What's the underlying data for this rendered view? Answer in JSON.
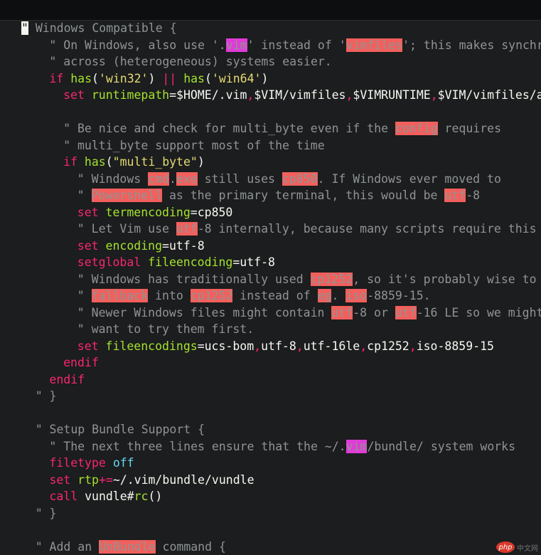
{
  "colors": {
    "background": "#1b1d1e",
    "comment": "#909493",
    "keyword": "#f92672",
    "function": "#a6e22e",
    "string": "#e6db74",
    "spell_bad": "#f25f5c",
    "spell_rare": "#e03bd8"
  },
  "editor": {
    "lines": [
      {
        "indent": 0,
        "tokens": [
          {
            "t": "\"",
            "c": "cursor"
          },
          {
            "t": " Windows Compatible {",
            "c": "comment"
          }
        ]
      },
      {
        "indent": 2,
        "tokens": [
          {
            "t": "\" On Windows, also use '.",
            "c": "comment"
          },
          {
            "t": "vim",
            "c": "spell-magenta"
          },
          {
            "t": "' instead of '",
            "c": "comment"
          },
          {
            "t": "vimfiles",
            "c": "spell-red"
          },
          {
            "t": "'; this makes synchro",
            "c": "comment"
          },
          {
            "t": "#",
            "c": "normal"
          }
        ]
      },
      {
        "indent": 2,
        "tokens": [
          {
            "t": "\" across (heterogeneous) systems easier.",
            "c": "comment"
          }
        ]
      },
      {
        "indent": 2,
        "tokens": [
          {
            "t": "if",
            "c": "keyword"
          },
          {
            "t": " ",
            "c": "normal"
          },
          {
            "t": "has",
            "c": "function"
          },
          {
            "t": "(",
            "c": "normal"
          },
          {
            "t": "'win32'",
            "c": "string"
          },
          {
            "t": ") ",
            "c": "normal"
          },
          {
            "t": "||",
            "c": "keyword"
          },
          {
            "t": " ",
            "c": "normal"
          },
          {
            "t": "has",
            "c": "function"
          },
          {
            "t": "(",
            "c": "normal"
          },
          {
            "t": "'win64'",
            "c": "string"
          },
          {
            "t": ")",
            "c": "normal"
          }
        ]
      },
      {
        "indent": 3,
        "tokens": [
          {
            "t": "set",
            "c": "keyword"
          },
          {
            "t": " ",
            "c": "normal"
          },
          {
            "t": "runtimepath",
            "c": "function"
          },
          {
            "t": "=$HOME/.vim",
            "c": "normal"
          },
          {
            "t": ",",
            "c": "sep-red"
          },
          {
            "t": "$VIM/vimfiles",
            "c": "normal"
          },
          {
            "t": ",",
            "c": "sep-red"
          },
          {
            "t": "$VIMRUNTIME",
            "c": "normal"
          },
          {
            "t": ",",
            "c": "sep-red"
          },
          {
            "t": "$VIM/vimfiles/af",
            "c": "normal"
          },
          {
            "t": "#",
            "c": "normal"
          }
        ]
      },
      {
        "indent": 0,
        "tokens": []
      },
      {
        "indent": 3,
        "tokens": [
          {
            "t": "\" Be nice and check for multi_byte even if the ",
            "c": "comment"
          },
          {
            "t": "config",
            "c": "spell-red"
          },
          {
            "t": " requires",
            "c": "comment"
          }
        ]
      },
      {
        "indent": 3,
        "tokens": [
          {
            "t": "\" multi_byte support most of the time",
            "c": "comment"
          }
        ]
      },
      {
        "indent": 3,
        "tokens": [
          {
            "t": "if",
            "c": "keyword"
          },
          {
            "t": " ",
            "c": "normal"
          },
          {
            "t": "has",
            "c": "function"
          },
          {
            "t": "(",
            "c": "normal"
          },
          {
            "t": "\"multi_byte\"",
            "c": "string"
          },
          {
            "t": ")",
            "c": "normal"
          }
        ]
      },
      {
        "indent": 4,
        "tokens": [
          {
            "t": "\" Windows ",
            "c": "comment"
          },
          {
            "t": "cmd",
            "c": "spell-red"
          },
          {
            "t": ".",
            "c": "comment"
          },
          {
            "t": "exe",
            "c": "spell-red"
          },
          {
            "t": " still uses ",
            "c": "comment"
          },
          {
            "t": "cp850",
            "c": "spell-red"
          },
          {
            "t": ". If Windows ever moved to",
            "c": "comment"
          }
        ]
      },
      {
        "indent": 4,
        "tokens": [
          {
            "t": "\" ",
            "c": "comment"
          },
          {
            "t": "Powershell",
            "c": "spell-red"
          },
          {
            "t": " as the primary terminal, this would be ",
            "c": "comment"
          },
          {
            "t": "utf",
            "c": "spell-red"
          },
          {
            "t": "-8",
            "c": "comment"
          }
        ]
      },
      {
        "indent": 4,
        "tokens": [
          {
            "t": "set",
            "c": "keyword"
          },
          {
            "t": " ",
            "c": "normal"
          },
          {
            "t": "termencoding",
            "c": "function"
          },
          {
            "t": "=cp850",
            "c": "normal"
          }
        ]
      },
      {
        "indent": 4,
        "tokens": [
          {
            "t": "\" Let Vim use ",
            "c": "comment"
          },
          {
            "t": "utf",
            "c": "spell-red"
          },
          {
            "t": "-8 internally, because many scripts require this",
            "c": "comment"
          }
        ]
      },
      {
        "indent": 4,
        "tokens": [
          {
            "t": "set",
            "c": "keyword"
          },
          {
            "t": " ",
            "c": "normal"
          },
          {
            "t": "encoding",
            "c": "function"
          },
          {
            "t": "=utf-8",
            "c": "normal"
          }
        ]
      },
      {
        "indent": 4,
        "tokens": [
          {
            "t": "setglobal",
            "c": "keyword"
          },
          {
            "t": " ",
            "c": "normal"
          },
          {
            "t": "fileencoding",
            "c": "function"
          },
          {
            "t": "=utf-8",
            "c": "normal"
          }
        ]
      },
      {
        "indent": 4,
        "tokens": [
          {
            "t": "\" Windows has traditionally used ",
            "c": "comment"
          },
          {
            "t": "cp1252",
            "c": "spell-red"
          },
          {
            "t": ", so it's probably wise to",
            "c": "comment"
          }
        ]
      },
      {
        "indent": 4,
        "tokens": [
          {
            "t": "\" ",
            "c": "comment"
          },
          {
            "t": "fallback",
            "c": "spell-red"
          },
          {
            "t": " into ",
            "c": "comment"
          },
          {
            "t": "cp1252",
            "c": "spell-red"
          },
          {
            "t": " instead of ",
            "c": "comment"
          },
          {
            "t": "eg",
            "c": "spell-red"
          },
          {
            "t": ". ",
            "c": "comment"
          },
          {
            "t": "iso",
            "c": "spell-red"
          },
          {
            "t": "-8859-15.",
            "c": "comment"
          }
        ]
      },
      {
        "indent": 4,
        "tokens": [
          {
            "t": "\" Newer Windows files might contain ",
            "c": "comment"
          },
          {
            "t": "utf",
            "c": "spell-red"
          },
          {
            "t": "-8 or ",
            "c": "comment"
          },
          {
            "t": "utf",
            "c": "spell-red"
          },
          {
            "t": "-16 LE so we might",
            "c": "comment"
          }
        ]
      },
      {
        "indent": 4,
        "tokens": [
          {
            "t": "\" want to try them first.",
            "c": "comment"
          }
        ]
      },
      {
        "indent": 4,
        "tokens": [
          {
            "t": "set",
            "c": "keyword"
          },
          {
            "t": " ",
            "c": "normal"
          },
          {
            "t": "fileencodings",
            "c": "function"
          },
          {
            "t": "=ucs-bom",
            "c": "normal"
          },
          {
            "t": ",",
            "c": "sep-red"
          },
          {
            "t": "utf-8",
            "c": "normal"
          },
          {
            "t": ",",
            "c": "sep-red"
          },
          {
            "t": "utf-16le",
            "c": "normal"
          },
          {
            "t": ",",
            "c": "sep-red"
          },
          {
            "t": "cp1252",
            "c": "normal"
          },
          {
            "t": ",",
            "c": "sep-red"
          },
          {
            "t": "iso-8859-15",
            "c": "normal"
          }
        ]
      },
      {
        "indent": 3,
        "tokens": [
          {
            "t": "endif",
            "c": "keyword"
          }
        ]
      },
      {
        "indent": 2,
        "tokens": [
          {
            "t": "endif",
            "c": "keyword"
          }
        ]
      },
      {
        "indent": 1,
        "tokens": [
          {
            "t": "\" }",
            "c": "comment"
          }
        ]
      },
      {
        "indent": 0,
        "tokens": []
      },
      {
        "indent": 1,
        "tokens": [
          {
            "t": "\" Setup Bundle Support {",
            "c": "comment"
          }
        ]
      },
      {
        "indent": 2,
        "tokens": [
          {
            "t": "\" The next three lines ensure that the ~/.",
            "c": "comment"
          },
          {
            "t": "vim",
            "c": "spell-magenta"
          },
          {
            "t": "/bundle/ system works",
            "c": "comment"
          }
        ]
      },
      {
        "indent": 2,
        "tokens": [
          {
            "t": "filetype",
            "c": "keyword"
          },
          {
            "t": " ",
            "c": "normal"
          },
          {
            "t": "off",
            "c": "constant"
          }
        ]
      },
      {
        "indent": 2,
        "tokens": [
          {
            "t": "set",
            "c": "keyword"
          },
          {
            "t": " ",
            "c": "normal"
          },
          {
            "t": "rtp",
            "c": "function"
          },
          {
            "t": "+=",
            "c": "keyword"
          },
          {
            "t": "~/.vim/bundle/vundle",
            "c": "normal"
          }
        ]
      },
      {
        "indent": 2,
        "tokens": [
          {
            "t": "call",
            "c": "keyword"
          },
          {
            "t": " vundle#",
            "c": "normal"
          },
          {
            "t": "rc",
            "c": "function"
          },
          {
            "t": "()",
            "c": "normal"
          }
        ]
      },
      {
        "indent": 1,
        "tokens": [
          {
            "t": "\" }",
            "c": "comment"
          }
        ]
      },
      {
        "indent": 0,
        "tokens": []
      },
      {
        "indent": 1,
        "tokens": [
          {
            "t": "\" Add an ",
            "c": "comment"
          },
          {
            "t": "UnBundle",
            "c": "spell-red"
          },
          {
            "t": " command {",
            "c": "comment"
          }
        ]
      }
    ]
  },
  "watermark": {
    "logo": "php",
    "text": "中文网"
  }
}
